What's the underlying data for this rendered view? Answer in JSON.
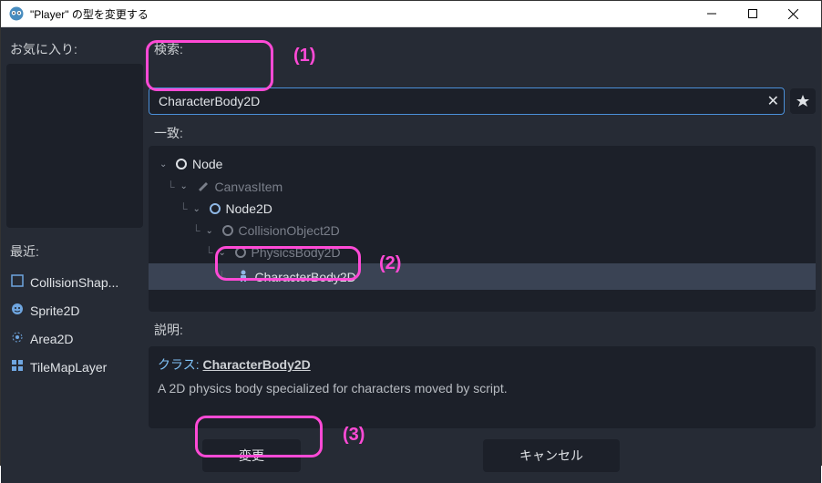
{
  "window": {
    "title": "\"Player\" の型を変更する"
  },
  "sidebar": {
    "favorites_label": "お気に入り:",
    "recent_label": "最近:",
    "recent_items": [
      {
        "name": "CollisionShap...",
        "icon": "collisionshape"
      },
      {
        "name": "Sprite2D",
        "icon": "sprite2d"
      },
      {
        "name": "Area2D",
        "icon": "area2d"
      },
      {
        "name": "TileMapLayer",
        "icon": "tilemap"
      }
    ]
  },
  "search": {
    "label": "検索:",
    "value": "CharacterBody2D"
  },
  "match": {
    "label": "一致:",
    "tree": {
      "node": "Node",
      "canvas": "CanvasItem",
      "node2d": "Node2D",
      "collobj": "CollisionObject2D",
      "physbody": "PhysicsBody2D",
      "charbody": "CharacterBody2D"
    }
  },
  "description": {
    "label": "説明:",
    "class_prefix": "クラス: ",
    "class_name": "CharacterBody2D",
    "text": "A 2D physics body specialized for characters moved by script."
  },
  "buttons": {
    "change": "変更",
    "cancel": "キャンセル"
  },
  "annotations": {
    "one": "(1)",
    "two": "(2)",
    "three": "(3)"
  }
}
